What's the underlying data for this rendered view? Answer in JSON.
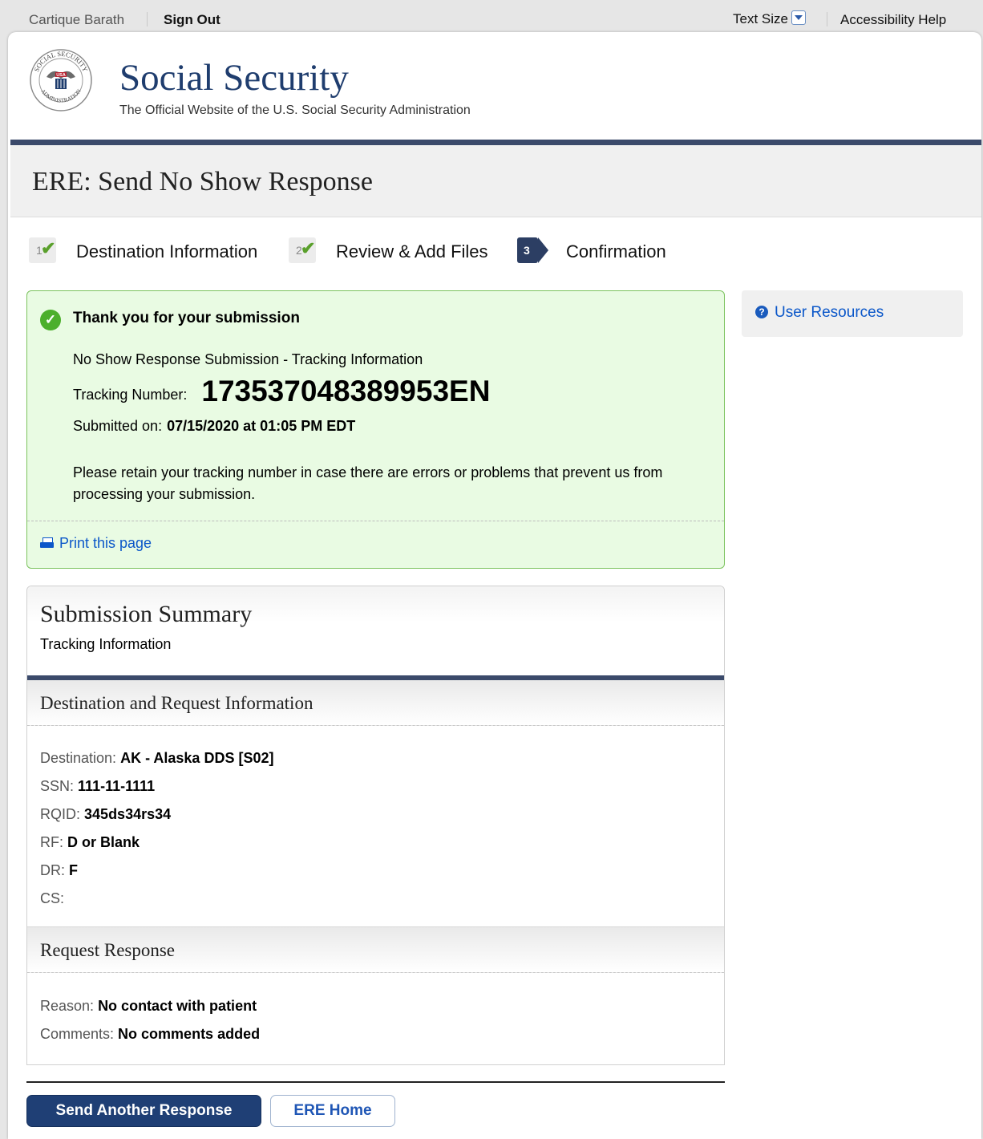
{
  "topbar": {
    "user": "Cartique Barath",
    "sign_out": "Sign Out",
    "text_size": "Text Size",
    "accessibility_help": "Accessibility Help"
  },
  "header": {
    "brand": "Social Security",
    "tagline": "The Official Website of the U.S. Social Security Administration",
    "seal_text_top": "SOCIAL SECURITY",
    "seal_text_bottom": "ADMINISTRATION",
    "seal_usa": "USA"
  },
  "page_title": "ERE: Send No Show Response",
  "steps": [
    {
      "number": "1",
      "label": "Destination Information",
      "status": "complete"
    },
    {
      "number": "2",
      "label": "Review & Add Files",
      "status": "complete"
    },
    {
      "number": "3",
      "label": "Confirmation",
      "status": "current"
    }
  ],
  "confirmation": {
    "title": "Thank you for your submission",
    "subtitle": "No Show Response Submission - Tracking Information",
    "tracking_label": "Tracking Number:",
    "tracking_number": "173537048389953EN",
    "submitted_label": "Submitted on:",
    "submitted_value": "07/15/2020 at 01:05 PM EDT",
    "note": "Please retain your tracking number in case there are errors or problems that prevent us from processing your submission.",
    "print_link": "Print this page"
  },
  "summary": {
    "title": "Submission Summary",
    "subtitle": "Tracking Information",
    "destination_section": {
      "heading": "Destination and Request Information",
      "fields": [
        {
          "label": "Destination:",
          "value": "AK - Alaska DDS [S02]"
        },
        {
          "label": "SSN:",
          "value": "111-11-1111"
        },
        {
          "label": "RQID:",
          "value": "345ds34rs34"
        },
        {
          "label": "RF:",
          "value": "D or Blank"
        },
        {
          "label": "DR:",
          "value": "F"
        },
        {
          "label": "CS:",
          "value": ""
        }
      ]
    },
    "response_section": {
      "heading": "Request Response",
      "fields": [
        {
          "label": "Reason:",
          "value": "No contact with patient"
        },
        {
          "label": "Comments:",
          "value": "No comments added"
        }
      ]
    }
  },
  "sidebar": {
    "user_resources": "User Resources"
  },
  "buttons": {
    "send_another": "Send Another Response",
    "ere_home": "ERE Home"
  },
  "colors": {
    "brand_navy": "#1f3d6e",
    "header_rule": "#3b4a6b",
    "success_bg": "#e9fbe3",
    "success_border": "#7cc35e",
    "link_blue": "#0b57c9",
    "primary_button": "#1f3f75"
  },
  "icons": {
    "success": "checkmark-circle-icon",
    "print": "printer-icon",
    "help": "question-circle-icon",
    "text_size": "chevron-down-icon"
  }
}
